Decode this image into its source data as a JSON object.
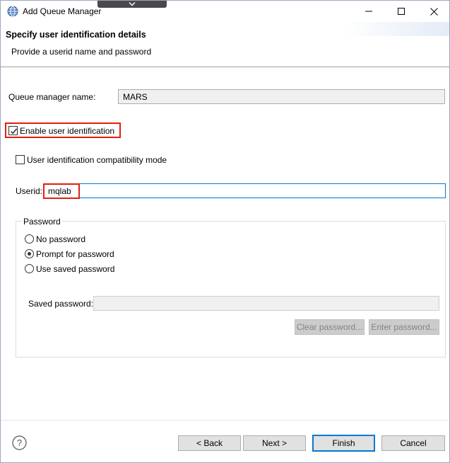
{
  "window": {
    "title": "Add Queue Manager"
  },
  "header": {
    "title": "Specify user identification details",
    "subtitle": "Provide a userid name and password"
  },
  "queue_manager": {
    "label": "Queue manager name:",
    "value": "MARS"
  },
  "enable_user_id": {
    "label": "Enable user identification",
    "checked": true
  },
  "compat_mode": {
    "label": "User identification compatibility mode",
    "checked": false
  },
  "userid": {
    "label": "Userid:",
    "value": "mqlab"
  },
  "password": {
    "group_label": "Password",
    "options": [
      {
        "label": "No password",
        "selected": false
      },
      {
        "label": "Prompt for password",
        "selected": true
      },
      {
        "label": "Use saved password",
        "selected": false
      }
    ],
    "saved_label": "Saved password:",
    "saved_value": "",
    "clear_button": "Clear password...",
    "enter_button": "Enter password..."
  },
  "footer": {
    "back": "< Back",
    "next": "Next >",
    "finish": "Finish",
    "cancel": "Cancel"
  },
  "colors": {
    "highlight": "#e0200c",
    "focus": "#0078d7"
  },
  "icons": [
    "app-globe-icon",
    "chevron-down-icon",
    "minimize-icon",
    "maximize-icon",
    "close-icon",
    "checkmark-icon",
    "help-icon"
  ]
}
